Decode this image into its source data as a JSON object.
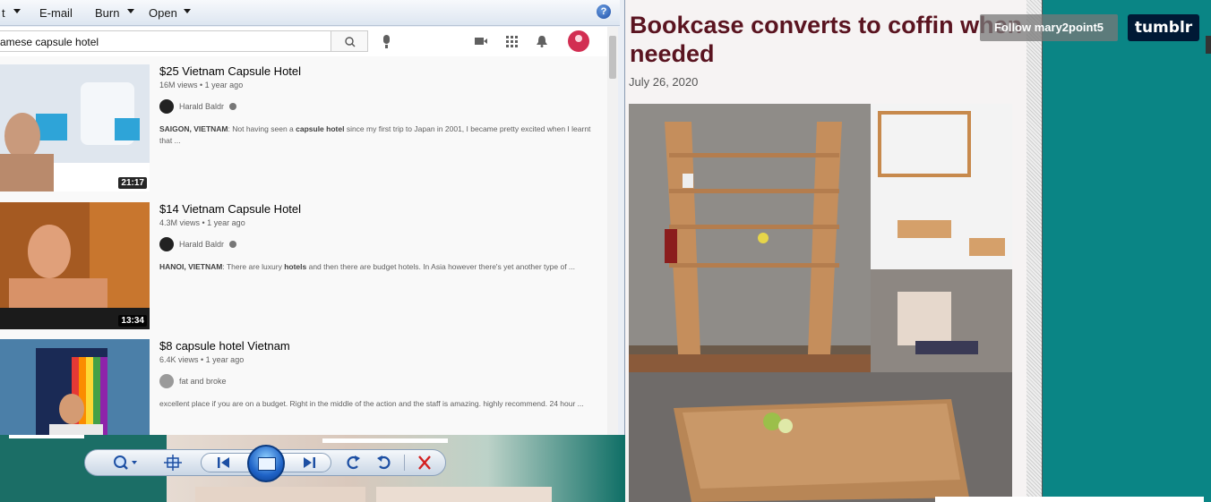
{
  "viewer": {
    "menu": {
      "partial": "t",
      "email": "E-mail",
      "burn": "Burn",
      "open": "Open"
    },
    "help_icon": "?"
  },
  "youtube": {
    "search_query": "amese capsule hotel",
    "results": [
      {
        "title": "$25 Vietnam Capsule Hotel",
        "meta": "16M views • 1 year ago",
        "channel": "Harald Baldr",
        "duration": "21:17",
        "desc_place": "SAIGON, VIETNAM",
        "desc_a": ": Not having seen a ",
        "desc_b": "capsule hotel",
        "desc_c": " since my first trip to Japan in 2001, I became pretty excited when I learnt that ..."
      },
      {
        "title": "$14 Vietnam Capsule Hotel",
        "meta": "4.3M views • 1 year ago",
        "channel": "Harald Baldr",
        "duration": "13:34",
        "desc_place": "HANOI, VIETNAM",
        "desc_a": ": There are luxury ",
        "desc_b": "hotels",
        "desc_c": " and then there are budget hotels. In Asia however there's yet another type of ..."
      },
      {
        "title": "$8 capsule hotel Vietnam",
        "meta": "6.4K views • 1 year ago",
        "channel": "fat and broke",
        "desc": "excellent place if you are on a budget. Right in the middle of the action and the staff is amazing. highly recommend. 24 hour ..."
      }
    ]
  },
  "tumblr": {
    "post_title": "Bookcase converts to coffin when needed",
    "post_date": "July 26, 2020",
    "follow": "Follow mary2point5",
    "logo": "tumblr",
    "accent": "#0a8585"
  }
}
